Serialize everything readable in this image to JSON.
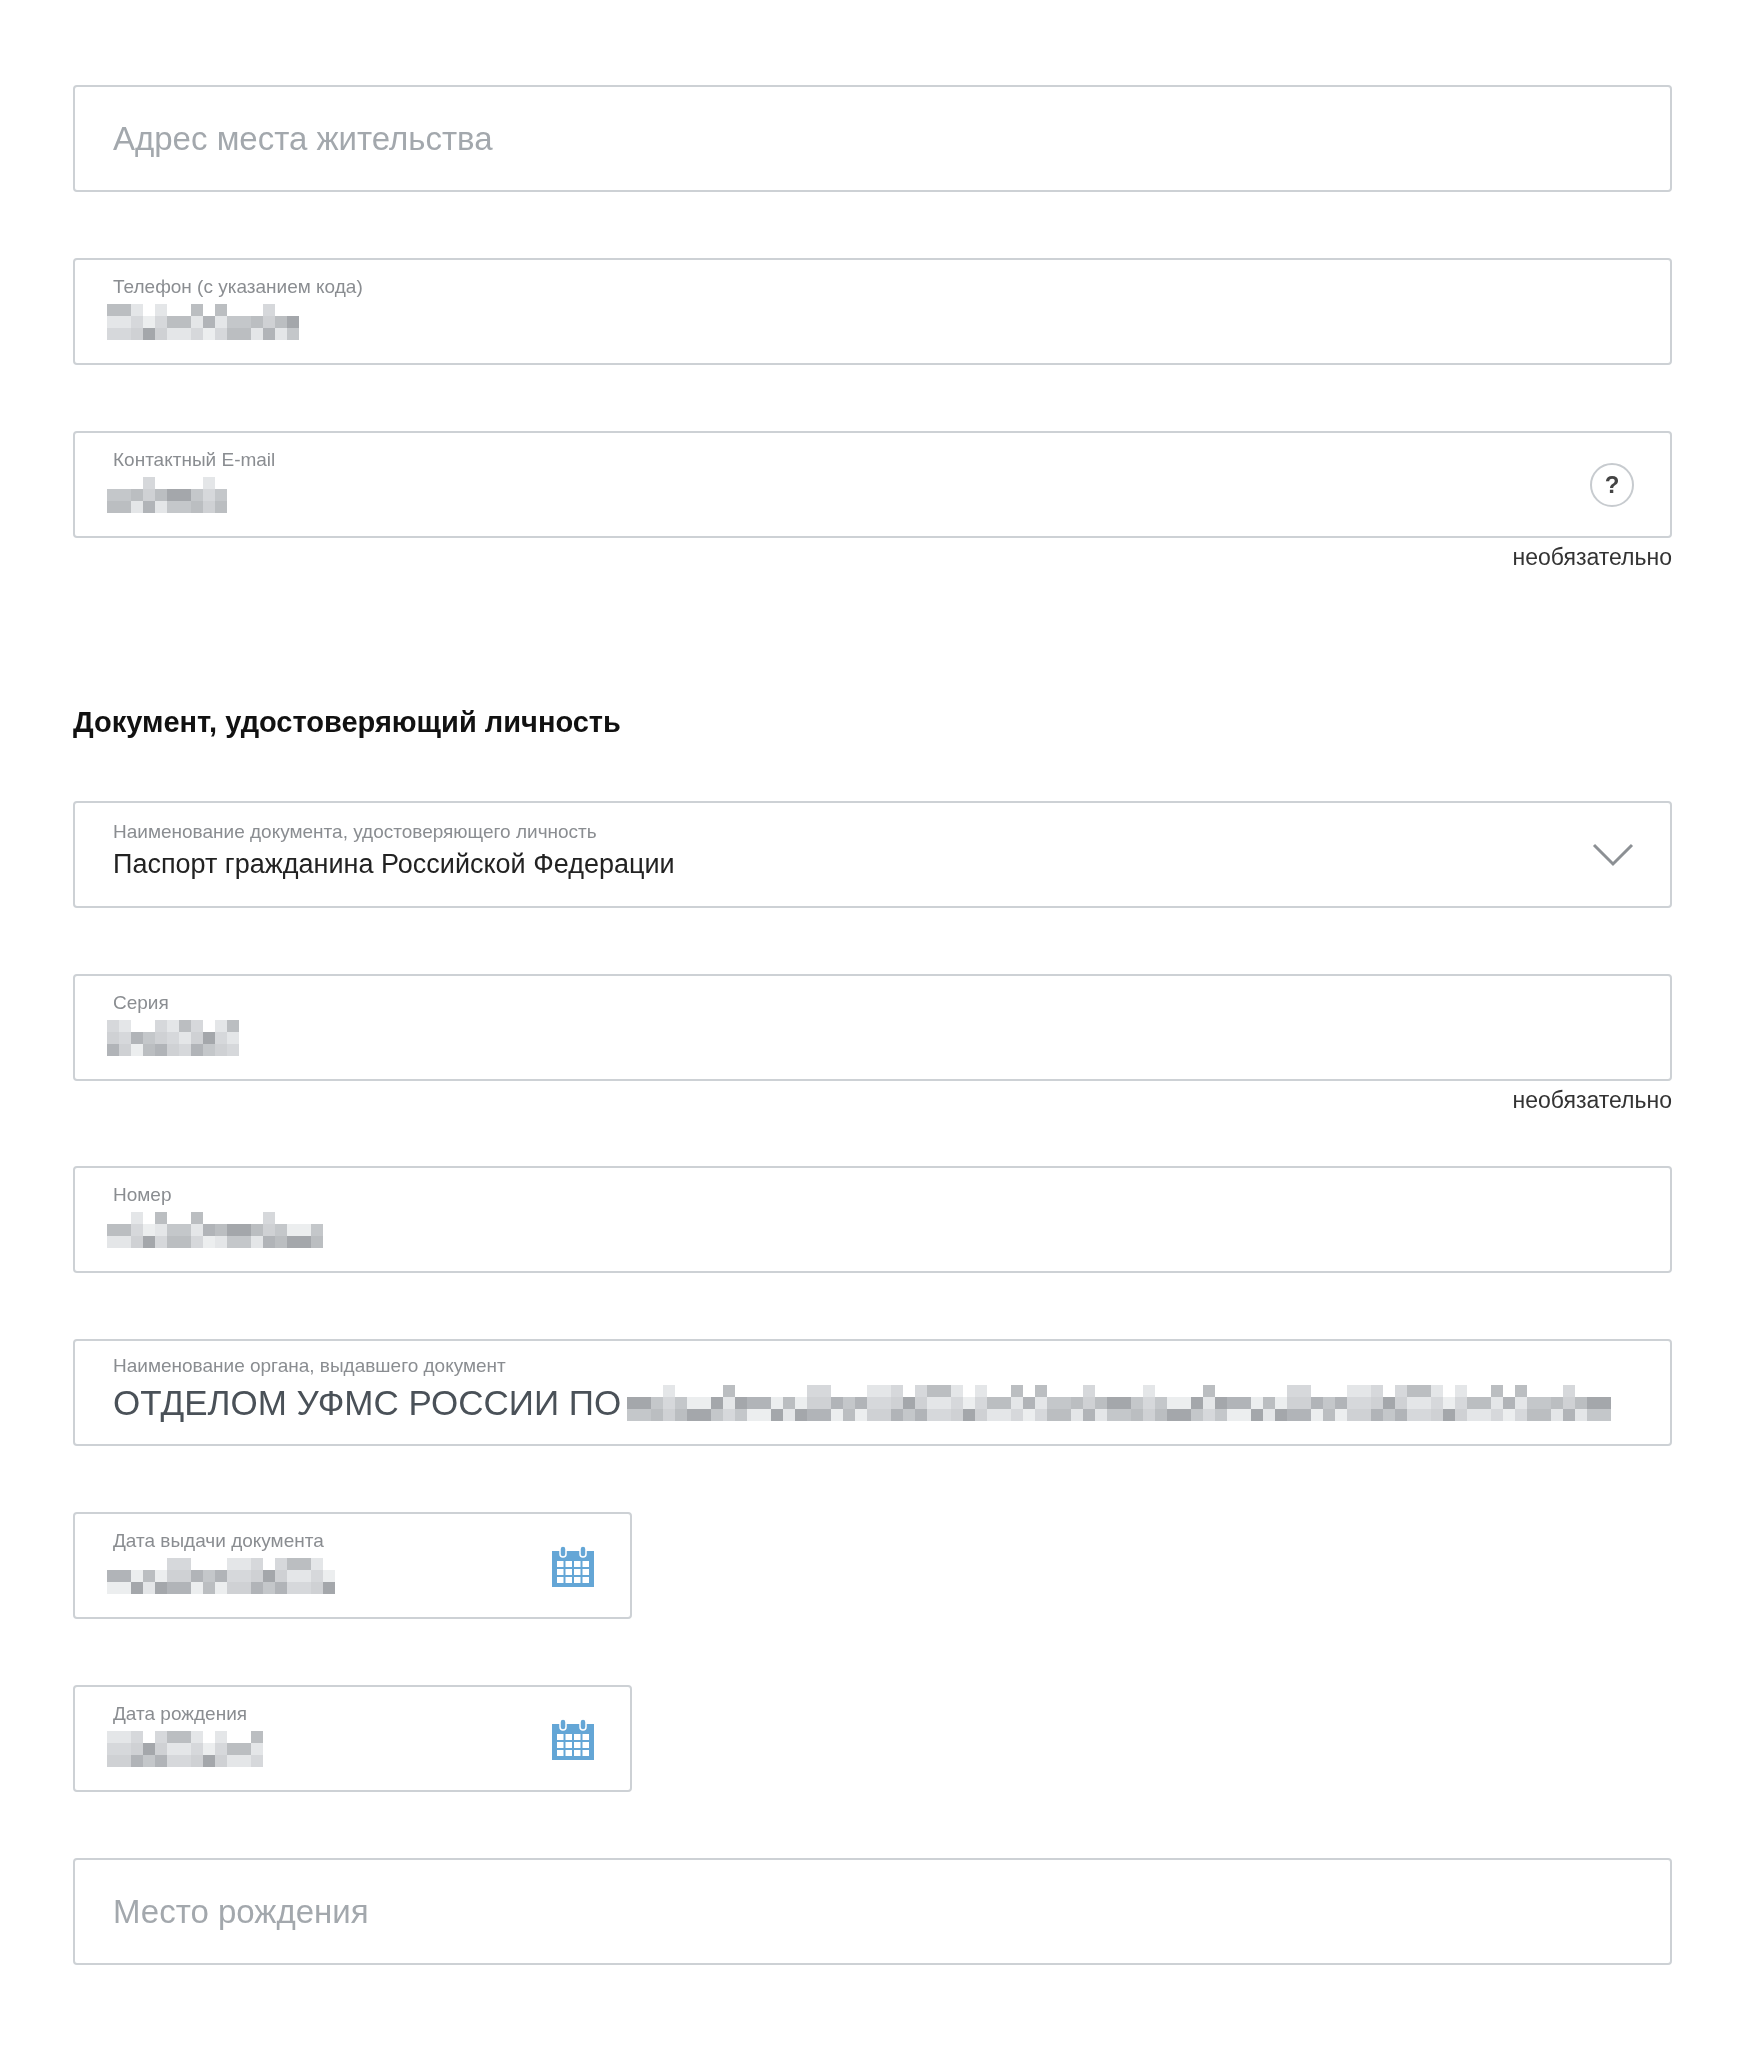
{
  "fields_top": [
    {
      "kind": "text",
      "placeholder": "Адрес места жительства"
    },
    {
      "kind": "text",
      "label": "Телефон (с указанием кода)",
      "value_redacted": true
    },
    {
      "kind": "text",
      "label": "Контактный E-mail",
      "value_redacted": true,
      "help_button": "?",
      "note": "необязательно"
    }
  ],
  "section": {
    "title": "Документ, удостоверяющий личность",
    "fields": [
      {
        "kind": "select",
        "label": "Наименование документа, удостоверяющего личность",
        "value": "Паспорт гражданина Российской Федерации"
      },
      {
        "kind": "text",
        "label": "Серия",
        "value_redacted": true,
        "note": "необязательно"
      },
      {
        "kind": "text",
        "label": "Номер",
        "value_redacted": true
      },
      {
        "kind": "text",
        "label": "Наименование органа, выдавшего документ",
        "value": "ОТДЕЛОМ УФМС РОССИИ ПО",
        "value_redacted": true
      },
      {
        "kind": "date",
        "label": "Дата выдачи документа",
        "value_redacted": true
      },
      {
        "kind": "date",
        "label": "Дата рождения",
        "value_redacted": true
      },
      {
        "kind": "text",
        "placeholder": "Место рождения"
      }
    ]
  }
}
